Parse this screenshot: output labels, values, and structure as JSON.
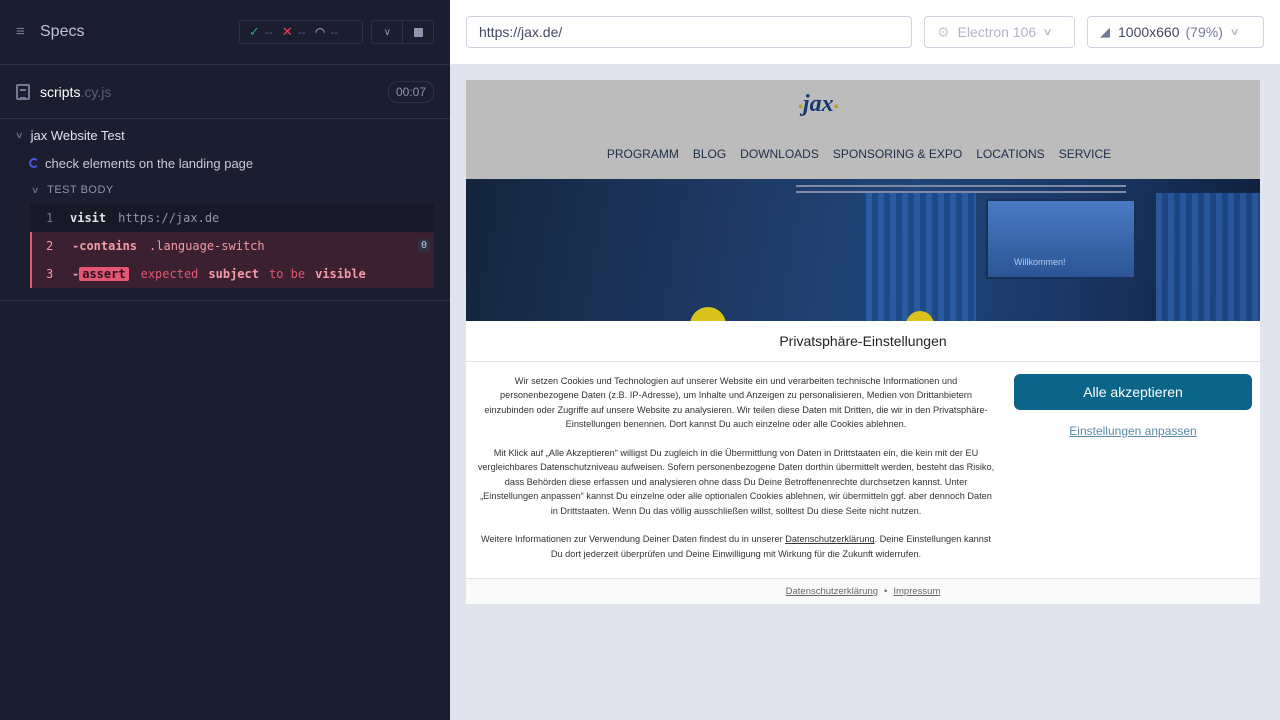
{
  "reporter": {
    "title": "Specs",
    "stats": {
      "passed": "--",
      "failed": "--",
      "pending": "--"
    },
    "spec_file": {
      "name": "scripts",
      "ext": ".cy.js",
      "duration": "00:07"
    },
    "suite": "jax Website Test",
    "test": "check elements on the landing page",
    "body_label": "TEST BODY",
    "commands": [
      {
        "num": "1",
        "name": "visit",
        "message": "https://jax.de"
      },
      {
        "num": "2",
        "name": "-contains",
        "message": ".language-switch",
        "count": "0"
      },
      {
        "num": "3",
        "prefix": "-",
        "name": "assert",
        "words": [
          "expected",
          "subject",
          "to be",
          "visible"
        ]
      }
    ]
  },
  "aut": {
    "url": "https://jax.de/",
    "browser": "Electron 106",
    "viewport": "1000x660",
    "scale": "(79%)"
  },
  "site": {
    "logo": "jax",
    "nav": [
      "PROGRAMM",
      "BLOG",
      "DOWNLOADS",
      "SPONSORING & EXPO",
      "LOCATIONS",
      "SERVICE"
    ],
    "hero_screen_text": "Willkommen!",
    "consent": {
      "title": "Privatsphäre-Einstellungen",
      "p1": "Wir setzen Cookies und Technologien auf unserer Website ein und verarbeiten technische Informationen und personenbezogene Daten (z.B. IP-Adresse), um Inhalte und Anzeigen zu personalisieren, Medien von Drittanbietern einzubinden oder Zugriffe auf unsere Website zu analysieren. Wir teilen diese Daten mit Dritten, die wir in den Privatsphäre-Einstellungen benennen. Dort kannst Du auch einzelne oder alle Cookies ablehnen.",
      "p2": "Mit Klick auf „Alle Akzeptieren“ willigst Du zugleich in die Übermittlung von Daten in Drittstaaten ein, die kein mit der EU vergleichbares Datenschutzniveau aufweisen. Sofern personenbezogene Daten dorthin übermittelt werden, besteht das Risiko, dass Behörden diese erfassen und analysieren ohne dass Du Deine Betroffenenrechte durchsetzen kannst. Unter „Einstellungen anpassen“ kannst Du einzelne oder alle optionalen Cookies ablehnen, wir übermitteln ggf. aber dennoch Daten in Drittstaaten. Wenn Du das völlig ausschließen willst, solltest Du diese Seite nicht nutzen.",
      "p3_before": "Weitere Informationen zur Verwendung Deiner Daten findest du in unserer ",
      "p3_link": "Datenschutzerklärung",
      "p3_after": ". Deine Einstellungen kannst Du dort jederzeit überprüfen und Deine Einwilligung mit Wirkung für die Zukunft widerrufen.",
      "accept": "Alle akzeptieren",
      "settings": "Einstellungen anpassen",
      "footer_privacy": "Datenschutzerklärung",
      "footer_sep": "•",
      "footer_imprint": "Impressum"
    }
  },
  "colors": {
    "reporter_bg": "#1b1e2e",
    "failed_bg": "#3a2031",
    "failed_accent": "#e45770",
    "accept_btn": "#0a6589",
    "aut_bg": "#e1e3ed"
  }
}
